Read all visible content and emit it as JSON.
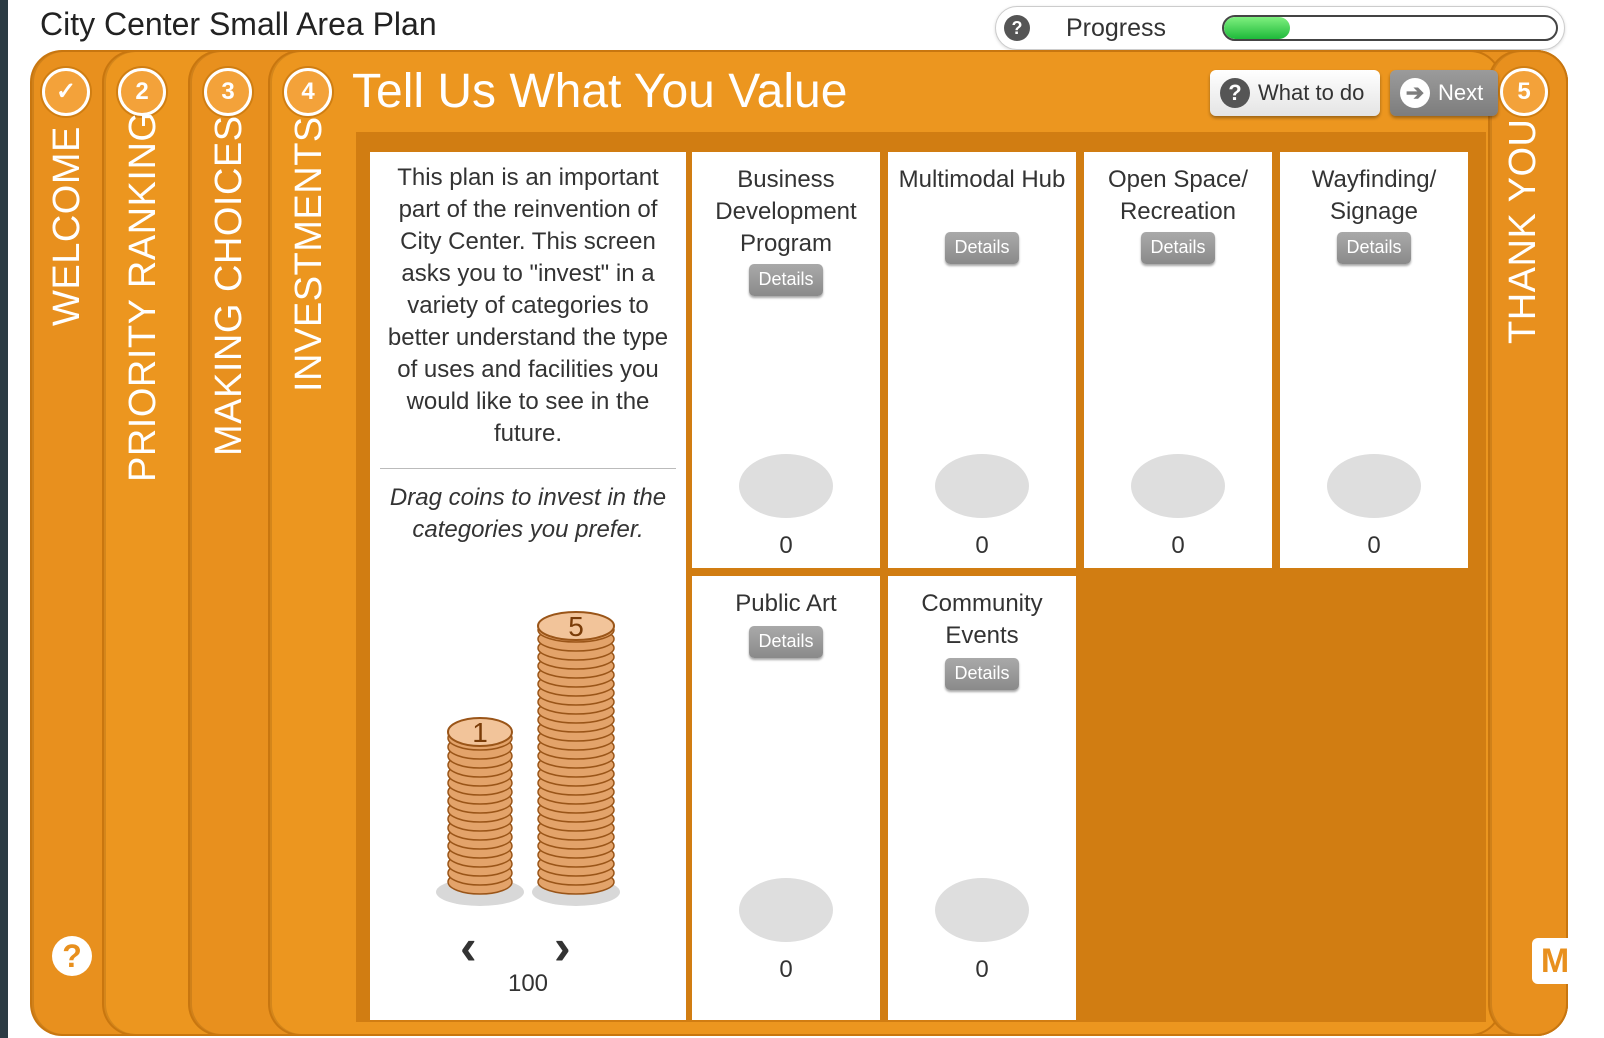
{
  "app": {
    "title": "City Center Small Area Plan"
  },
  "progress": {
    "label": "Progress",
    "help_icon": "question-icon",
    "value_fraction": 0.2
  },
  "steps": [
    {
      "number": "",
      "label": "WELCOME",
      "icon": "check-icon"
    },
    {
      "number": "2",
      "label": "PRIORITY RANKING"
    },
    {
      "number": "3",
      "label": "MAKING CHOICES"
    },
    {
      "number": "4",
      "label": "INVESTMENTS"
    },
    {
      "number": "5",
      "label": "THANK YOU"
    }
  ],
  "stage": {
    "title": "Tell Us What You Value",
    "what_to_do": "What to do",
    "next": "Next",
    "intro": "This plan is an important part of the reinvention of City Center. This screen asks you to \"invest\" in a variety of categories to better understand the type of uses and facilities you would like to see in the future.",
    "drag_hint": "Drag coins to invest in the categories you prefer.",
    "coin_total": "100",
    "coin_labels": [
      "1",
      "5"
    ]
  },
  "categories": [
    {
      "title": "Business Development Program",
      "details": "Details",
      "count": "0"
    },
    {
      "title": "Multimodal Hub",
      "details": "Details",
      "count": "0"
    },
    {
      "title": "Open Space/ Recreation",
      "details": "Details",
      "count": "0"
    },
    {
      "title": "Wayfinding/ Signage",
      "details": "Details",
      "count": "0"
    },
    {
      "title": "Public Art",
      "details": "Details",
      "count": "0"
    },
    {
      "title": "Community Events",
      "details": "Details",
      "count": "0"
    }
  ],
  "colors": {
    "accent": "#e8901e",
    "progress": "#1eb93a"
  }
}
